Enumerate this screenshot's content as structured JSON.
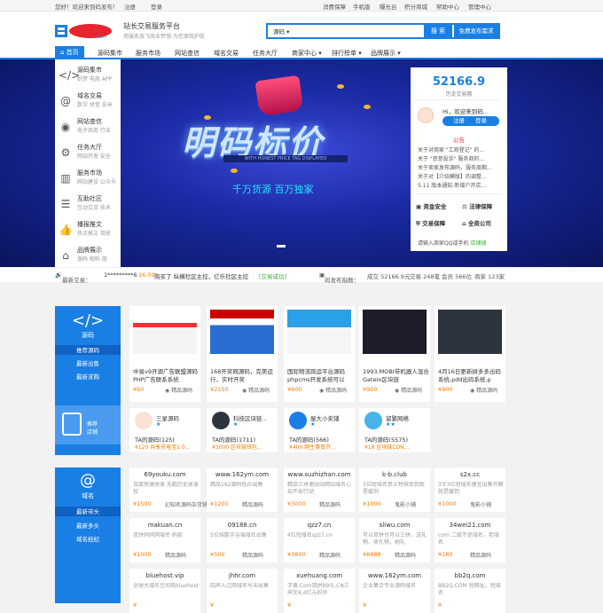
{
  "topbar": {
    "welcome": "您好！欢迎来到码发布！",
    "register": "注册",
    "login": "登录",
    "links": [
      "消费保障",
      "手机版",
      "曝光台",
      "积分商城",
      "帮助中心",
      "管理中心"
    ]
  },
  "header": {
    "site_title": "站长交易服务平台",
    "site_sub": "用服务放飞商业梦想·为您保驾护航",
    "search_category": "源码",
    "search_button": "搜 索",
    "publish_button": "免费发布需求"
  },
  "nav": [
    "首页",
    "源码集市",
    "服务市场",
    "网站查信",
    "域名交易",
    "任务大厅",
    "商家中心",
    "排行榜单",
    "品牌展示"
  ],
  "sidemenu": [
    {
      "icon": "code-icon",
      "glyph": "</>",
      "title": "源码集市",
      "sub": "织梦 电商 APP"
    },
    {
      "icon": "at-icon",
      "glyph": "@",
      "title": "域名交易",
      "sub": "数字 拼音 杂米"
    },
    {
      "icon": "globe-icon",
      "glyph": "◉",
      "title": "网站查信",
      "sub": "电子商务 行业"
    },
    {
      "icon": "gear-icon",
      "glyph": "⚙",
      "title": "任务大厅",
      "sub": "网站开发 安全"
    },
    {
      "icon": "chart-icon",
      "glyph": "▥",
      "title": "服务市场",
      "sub": "网站建设 公众号"
    },
    {
      "icon": "chat-icon",
      "glyph": "☰",
      "title": "互助社区",
      "sub": "互动交流 技术"
    },
    {
      "icon": "thumb-icon",
      "glyph": "👍",
      "title": "播报推文",
      "sub": "热点推文 驾驶"
    },
    {
      "icon": "home-icon",
      "glyph": "⌂",
      "title": "品牌展示",
      "sub": "源码 物料 商"
    }
  ],
  "banner": {
    "title": "明码标价",
    "strip": "WITH HONEST PRICE TAG DISPLAYED",
    "slogan": "千万货源  百万独家"
  },
  "card": {
    "number": "52166.9",
    "number_label": "历史交易额",
    "welcome": "Hi，欢迎来到码...",
    "register": "注册",
    "login": "登录",
    "notice_title": "公告",
    "notices": [
      "关于对商家 \"工商登记\" 的...",
      "关于 \"恶意投诉\" 服务商的...",
      "关于卖家发布源码，服务周期...",
      "关于对【介绍模版】的调整...",
      "5.11 版本通知-新增户开店..."
    ],
    "features": [
      "资金安全",
      "法律保障",
      "交易保障",
      "全资公司"
    ],
    "foot_text": "请输入商家QQ或手机",
    "foot_link": "店铺搜"
  },
  "ticker": {
    "label": "最新交易：",
    "user": "1*********6",
    "amount": "16.00",
    "desc": "购买了 纵横社区主控，亿乐社区主控",
    "status": "[交易成功]",
    "index_label": "码发布指数：",
    "deal": "成交 52166.9元",
    "trades": "交易 248笔",
    "members": "会员 566位",
    "sellers": "商家 123家"
  },
  "source_section": {
    "name": "源码",
    "links": [
      "推荐源码",
      "最新出售",
      "最新求购"
    ],
    "shop_promo": "推荐店铺",
    "products": [
      {
        "title": "中易v9开源广告联盟源码 PHP广告联系系统",
        "price": "¥60",
        "shop": "精品源码"
      },
      {
        "title": "168开奖网源码，完美运行，实时开奖",
        "price": "¥2150",
        "shop": "精品源码"
      },
      {
        "title": "国际物流跨运平台源码phpcms开发系统可以",
        "price": "¥600",
        "shop": "精品源码"
      },
      {
        "title": "1993.MOBI带机器人混合Gateio区块链",
        "price": "¥900",
        "shop": "精品源码"
      },
      {
        "title": "4月16日更新拼多多出码系统,pdd出码系统,p",
        "price": "¥900",
        "shop": "精品源码"
      }
    ],
    "shops": [
      {
        "name": "三星源码",
        "stars": "★",
        "title": "TA的源码(125)",
        "top": "¥120 共享充电宝2.0..."
      },
      {
        "name": "科技区块链...",
        "stars": "★",
        "title": "TA的源码(1711)",
        "top": "¥3000 区块链钱包..."
      },
      {
        "name": "屋大小卖铺",
        "stars": "★",
        "title": "TA的源码(566)",
        "top": "¥400 网生事变开..."
      },
      {
        "name": "留繁网络",
        "stars": "★★",
        "title": "TA的源码(5575)",
        "top": "¥18 区块链CDN..."
      }
    ]
  },
  "domain_section": {
    "name": "域名",
    "links": [
      "最新带头",
      "最新多头",
      "域名经纪"
    ],
    "rows": [
      [
        {
          "name": "69youku.com",
          "desc": "百度快速收录 无羁历史收录权",
          "price": "¥1500",
          "shop": "幻知名源码杂货铺"
        },
        {
          "name": "www.162ym.com",
          "desc": "精品162源码低价出售",
          "price": "¥1200",
          "shop": "精品源码"
        },
        {
          "name": "www.suzhizhan.com",
          "desc": "精品三拼速站站网站域名心如不如行动",
          "price": "¥3000",
          "shop": "精品源码"
        },
        {
          "name": "k-b.club",
          "desc": "3位短域名意义特殊受到就是缓到",
          "price": "¥1000",
          "shop": "鬼影小铺"
        },
        {
          "name": "s2x.cc",
          "desc": "3字3位短域名便宜出售开解就是缓到",
          "price": "¥1000",
          "shop": "鬼影小铺"
        }
      ],
      [
        {
          "name": "makuan.cn",
          "desc": "双拼码码网域名 妈款",
          "price": "¥1000",
          "shop": "精品源码"
        },
        {
          "name": "09188.cn",
          "desc": "5位纯数字吉福域名出售",
          "price": "¥500",
          "shop": "精品源码"
        },
        {
          "name": "qzz7.cn",
          "desc": "4位短域名qzz7.cn",
          "price": "¥3800",
          "shop": "精品源码"
        },
        {
          "name": "sliwu.com",
          "desc": "可以双拼也可以三拼，送礼物、收礼物，刷礼",
          "price": "¥8888",
          "shop": "精品源码"
        },
        {
          "name": "34wei21.com",
          "desc": "com 二级不是域名，老域名",
          "price": "¥180",
          "shop": "精品源码"
        }
      ],
      [
        {
          "name": "bluehost.vip",
          "desc": "全球大域名空间商bluehost",
          "price": "¥",
          "shop": ""
        },
        {
          "name": "jhhr.com",
          "desc": "四声入过网域名号未出售",
          "price": "¥",
          "shop": ""
        },
        {
          "name": "xuehuang.com",
          "desc": "学黄.Com双拼89元,CN三声完4,4亿元的外",
          "price": "¥",
          "shop": ""
        },
        {
          "name": "www.162ym.com",
          "desc": "企业集合专业源码域名",
          "price": "¥",
          "shop": ""
        },
        {
          "name": "bb2q.com",
          "desc": "BB2Q.COM 短网址，短域名",
          "price": "¥",
          "shop": ""
        }
      ]
    ]
  },
  "colors": {
    "brand": "#1a7fe5",
    "price": "#f27c00",
    "banner": "#1a2aa3"
  }
}
